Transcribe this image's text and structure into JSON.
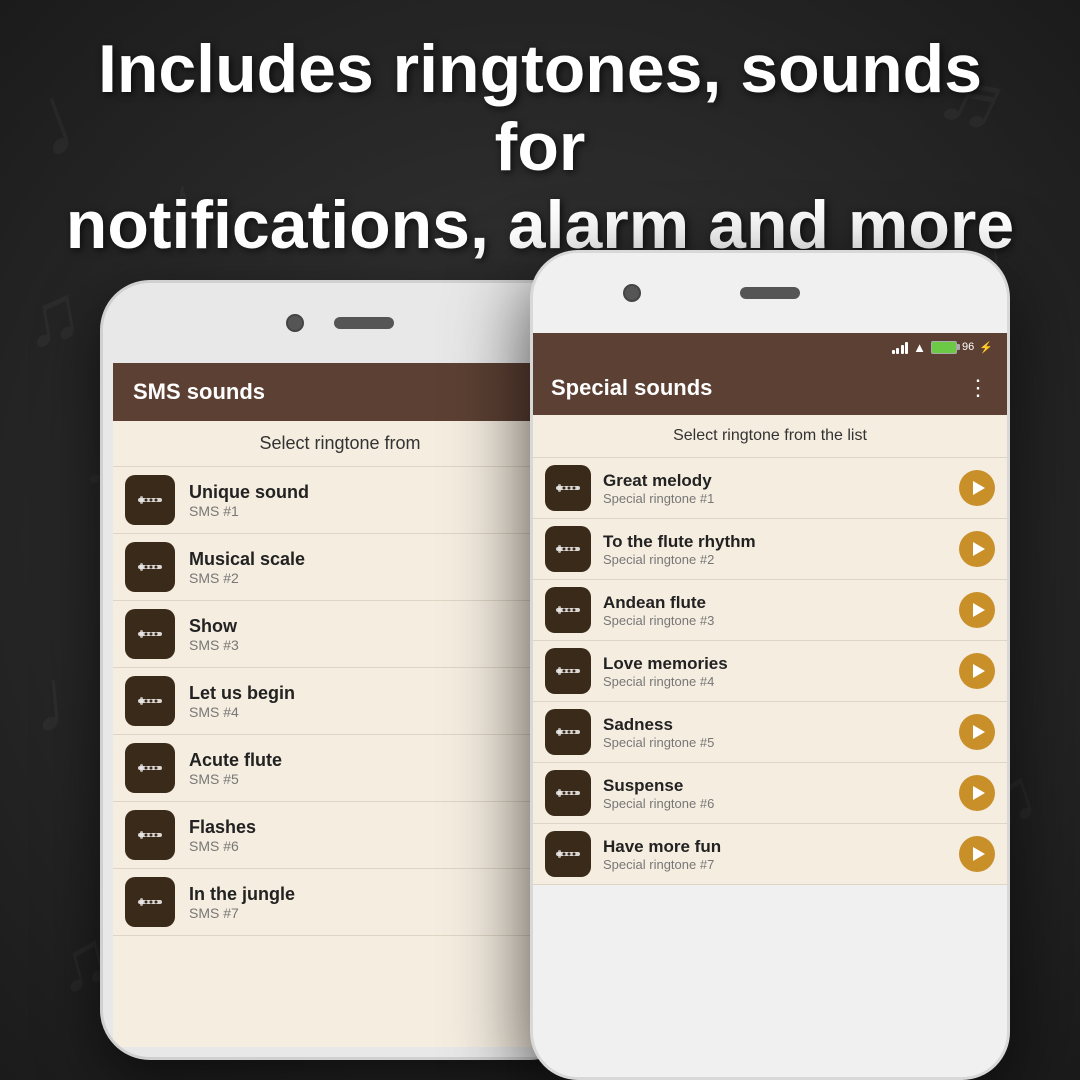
{
  "headline": {
    "line1": "Includes ringtones, sounds for",
    "line2": "notifications, alarm and more"
  },
  "phone_back": {
    "header_title": "SMS sounds",
    "subtitle": "Select ringtone from",
    "items": [
      {
        "title": "Unique sound",
        "sub": "SMS #1"
      },
      {
        "title": "Musical scale",
        "sub": "SMS #2"
      },
      {
        "title": "Show",
        "sub": "SMS #3"
      },
      {
        "title": "Let us begin",
        "sub": "SMS #4"
      },
      {
        "title": "Acute flute",
        "sub": "SMS #5"
      },
      {
        "title": "Flashes",
        "sub": "SMS #6"
      },
      {
        "title": "In the jungle",
        "sub": "SMS #7"
      }
    ]
  },
  "phone_front": {
    "header_title": "Special sounds",
    "menu_icon": "⋮",
    "subtitle": "Select ringtone from the list",
    "items": [
      {
        "title": "Great melody",
        "sub": "Special ringtone #1"
      },
      {
        "title": "To the flute rhythm",
        "sub": "Special ringtone #2"
      },
      {
        "title": "Andean flute",
        "sub": "Special ringtone #3"
      },
      {
        "title": "Love memories",
        "sub": "Special ringtone #4"
      },
      {
        "title": "Sadness",
        "sub": "Special ringtone #5"
      },
      {
        "title": "Suspense",
        "sub": "Special ringtone #6"
      },
      {
        "title": "Have more fun",
        "sub": "Special ringtone #7"
      }
    ]
  }
}
